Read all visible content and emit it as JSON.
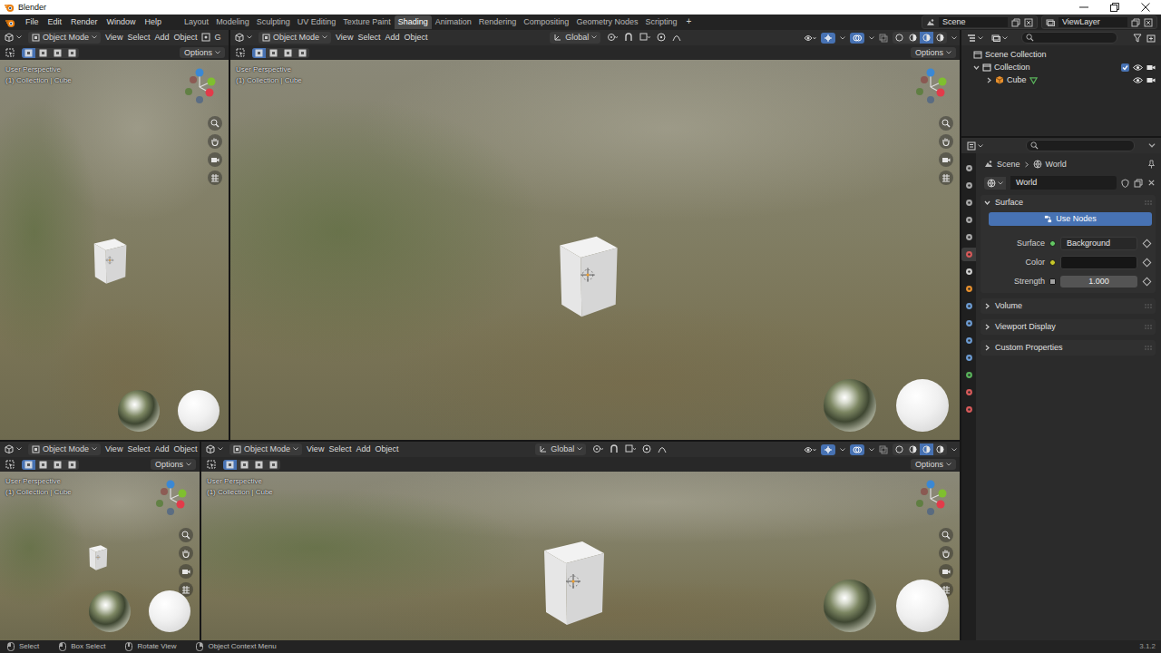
{
  "window": {
    "title": "Blender"
  },
  "menu": [
    "File",
    "Edit",
    "Render",
    "Window",
    "Help"
  ],
  "workspaces": [
    {
      "label": "Layout",
      "selected": false
    },
    {
      "label": "Modeling",
      "selected": false
    },
    {
      "label": "Sculpting",
      "selected": false
    },
    {
      "label": "UV Editing",
      "selected": false
    },
    {
      "label": "Texture Paint",
      "selected": false
    },
    {
      "label": "Shading",
      "selected": true
    },
    {
      "label": "Animation",
      "selected": false
    },
    {
      "label": "Rendering",
      "selected": false
    },
    {
      "label": "Compositing",
      "selected": false
    },
    {
      "label": "Geometry Nodes",
      "selected": false
    },
    {
      "label": "Scripting",
      "selected": false
    }
  ],
  "add_workspace": "+",
  "scene": "Scene",
  "view_layer": "ViewLayer",
  "select_modes": [
    {
      "selected": true
    },
    {
      "selected": false
    },
    {
      "selected": false
    },
    {
      "selected": false
    }
  ],
  "shading_modes": [
    {
      "selected": false
    },
    {
      "selected": false
    },
    {
      "selected": true
    },
    {
      "selected": false
    }
  ],
  "viewports": [
    {
      "kind": "narrow",
      "mode": "Object Mode",
      "menus": [
        "View",
        "Select",
        "Add",
        "Object"
      ],
      "orientation": "G",
      "options": "Options",
      "perspective": "User Perspective",
      "context": "(1) Collection | Cube"
    },
    {
      "kind": "wide",
      "mode": "Object Mode",
      "menus": [
        "View",
        "Select",
        "Add",
        "Object"
      ],
      "orientation": "Global",
      "options": "Options",
      "perspective": "User Perspective",
      "context": "(1) Collection | Cube"
    },
    {
      "kind": "narrow",
      "mode": "Object Mode",
      "menus": [
        "View",
        "Select",
        "Add",
        "Object"
      ],
      "orientation": "",
      "options": "Options",
      "perspective": "User Perspective",
      "context": "(1) Collection | Cube"
    },
    {
      "kind": "wide",
      "mode": "Object Mode",
      "menus": [
        "View",
        "Select",
        "Add",
        "Object"
      ],
      "orientation": "Global",
      "options": "Options",
      "perspective": "User Perspective",
      "context": "(1) Collection | Cube"
    }
  ],
  "outliner": {
    "items": [
      {
        "label": "Scene Collection",
        "kind": "scene"
      },
      {
        "label": "Collection",
        "kind": "collection",
        "expanded": true,
        "included": true,
        "visible": true,
        "renderable": true
      },
      {
        "label": "Cube",
        "kind": "object",
        "expanded": false,
        "visible": true,
        "renderable": true
      }
    ]
  },
  "properties": {
    "tabs": [
      {
        "color": "#a8a8a8",
        "selected": false
      },
      {
        "color": "#a8a8a8",
        "selected": false
      },
      {
        "color": "#a8a8a8",
        "selected": false
      },
      {
        "color": "#a8a8a8",
        "selected": false
      },
      {
        "color": "#a8a8a8",
        "selected": false
      },
      {
        "color": "#d85a5a",
        "selected": true
      },
      {
        "color": "#d0d0d0",
        "selected": false
      },
      {
        "color": "#e8902d",
        "selected": false
      },
      {
        "color": "#6c9bd2",
        "selected": false
      },
      {
        "color": "#6c9bd2",
        "selected": false
      },
      {
        "color": "#6c9bd2",
        "selected": false
      },
      {
        "color": "#6c9bd2",
        "selected": false
      },
      {
        "color": "#59b35b",
        "selected": false
      },
      {
        "color": "#d85a5a",
        "selected": false
      },
      {
        "color": "#d85a5a",
        "selected": false
      }
    ],
    "breadcrumb": [
      "Scene",
      "World"
    ],
    "datablock": "World",
    "panels": [
      {
        "label": "Surface",
        "expanded": true,
        "rows": [
          {
            "kind": "button",
            "label": "Use Nodes",
            "on": true
          },
          {
            "kind": "enum",
            "label": "Surface",
            "value": "Background"
          },
          {
            "kind": "color",
            "label": "Color",
            "swatch": "#161616"
          },
          {
            "kind": "slider",
            "label": "Strength",
            "value": "1.000"
          }
        ]
      },
      {
        "label": "Volume",
        "expanded": false,
        "rows": []
      },
      {
        "label": "Viewport Display",
        "expanded": false,
        "rows": []
      },
      {
        "label": "Custom Properties",
        "expanded": false,
        "rows": []
      }
    ]
  },
  "status": [
    {
      "label": "Select"
    },
    {
      "label": "Box Select"
    },
    {
      "label": "Rotate View"
    },
    {
      "label": "Object Context Menu"
    }
  ],
  "version": "3.1.2"
}
